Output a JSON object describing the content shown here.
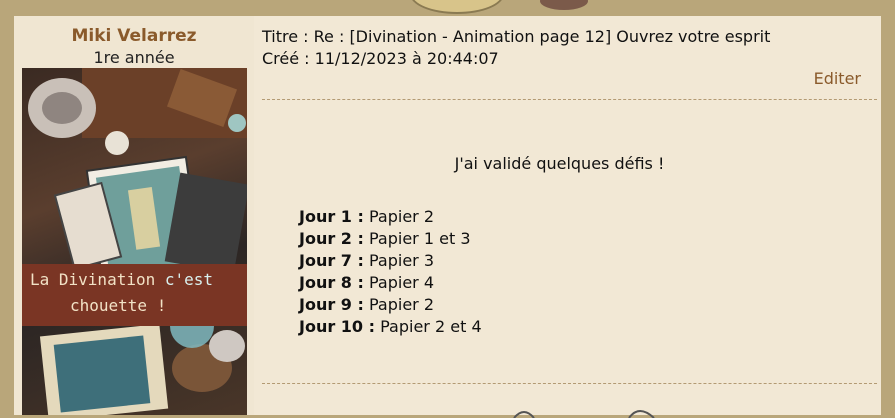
{
  "post": {
    "author": {
      "name": "Miki Velarrez",
      "rank": "1re année",
      "avatar_caption_line1_a": "La Divination ",
      "avatar_caption_line1_b": "c'est",
      "avatar_caption_line2": "chouette !"
    },
    "title_line": "Titre : Re : [Divination - Animation page 12] Ouvrez votre esprit",
    "created_line": "Créé : 11/12/2023 à 20:44:07",
    "edit_label": "Editer",
    "message": {
      "intro": "J'ai validé quelques défis !",
      "days": [
        {
          "label": "Jour 1 :",
          "value": "Papier 2"
        },
        {
          "label": "Jour 2 :",
          "value": "Papier 1 et 3"
        },
        {
          "label": "Jour 7 :",
          "value": "Papier 3"
        },
        {
          "label": "Jour 8 :",
          "value": "Papier 4"
        },
        {
          "label": "Jour 9 :",
          "value": "Papier 2"
        },
        {
          "label": "Jour 10 :",
          "value": "Papier 2 et 4"
        }
      ]
    }
  },
  "colors": {
    "frame": "#b9a67a",
    "panel": "#f2e8d5",
    "author_accent": "#8a5a2b",
    "divider": "#b39a73"
  }
}
